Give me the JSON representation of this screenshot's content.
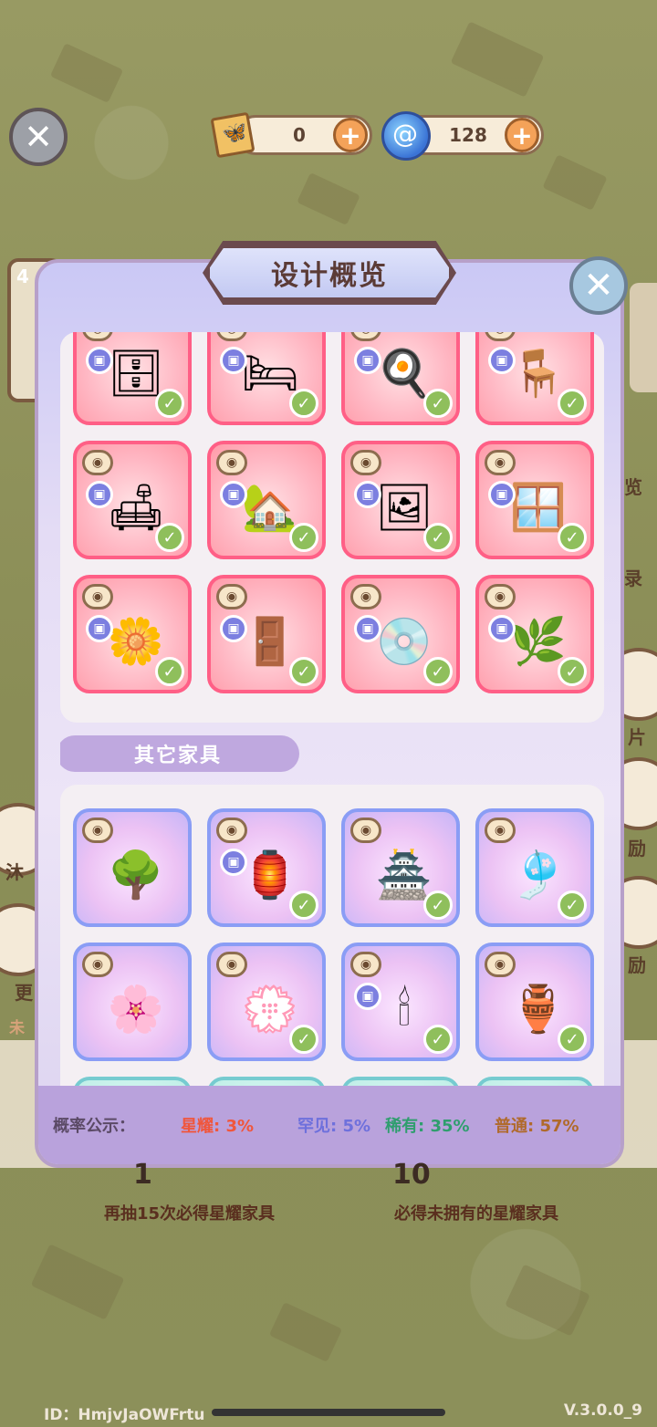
{
  "header": {
    "close_label": "✕",
    "currencies": [
      {
        "name": "butterfly-scroll",
        "value": "0",
        "plus": "+"
      },
      {
        "name": "blue-orb",
        "value": "128",
        "plus": "+"
      }
    ]
  },
  "dialog": {
    "title": "设计概览",
    "close_label": "✕",
    "sections": [
      {
        "items": [
          {
            "style": "pink",
            "name": "wooden-desk",
            "icon": "🗄",
            "badge": true,
            "check": true
          },
          {
            "style": "pink",
            "name": "flower-bed",
            "icon": "🛏",
            "badge": true,
            "check": true
          },
          {
            "style": "pink",
            "name": "kitchen-cabinet",
            "icon": "🍳",
            "badge": true,
            "check": true
          },
          {
            "style": "pink",
            "name": "office-chair",
            "icon": "🪑",
            "badge": true,
            "check": true
          },
          {
            "style": "pink",
            "name": "cream-sofa",
            "icon": "🛋",
            "badge": true,
            "check": true
          },
          {
            "style": "pink",
            "name": "flower-canopy-bed",
            "icon": "🏡",
            "badge": true,
            "check": true
          },
          {
            "style": "pink",
            "name": "easel",
            "icon": "🖼",
            "badge": true,
            "check": true
          },
          {
            "style": "pink",
            "name": "window-nook",
            "icon": "🪟",
            "badge": true,
            "check": true
          },
          {
            "style": "pink",
            "name": "flower-wall",
            "icon": "🌼",
            "badge": true,
            "check": true
          },
          {
            "style": "pink",
            "name": "wooden-door",
            "icon": "🚪",
            "badge": true,
            "check": true
          },
          {
            "style": "pink",
            "name": "record-shelf",
            "icon": "💿",
            "badge": true,
            "check": true
          },
          {
            "style": "pink",
            "name": "glass-counter",
            "icon": "🌿",
            "badge": true,
            "check": true
          }
        ]
      },
      {
        "label": "其它家具",
        "items": [
          {
            "style": "purple",
            "name": "tree",
            "icon": "🌳",
            "badge": false,
            "check": false
          },
          {
            "style": "purple",
            "name": "stone-lantern",
            "icon": "🏮",
            "badge": true,
            "check": true
          },
          {
            "style": "purple",
            "name": "lattice-screen",
            "icon": "🏯",
            "badge": false,
            "check": true
          },
          {
            "style": "purple",
            "name": "fan-lamp",
            "icon": "🎐",
            "badge": false,
            "check": true
          },
          {
            "style": "purple",
            "name": "blossom-rug",
            "icon": "🌸",
            "badge": false,
            "check": false
          },
          {
            "style": "purple",
            "name": "flower-mat",
            "icon": "💮",
            "badge": false,
            "check": true
          },
          {
            "style": "purple",
            "name": "candle",
            "icon": "🕯",
            "badge": true,
            "check": true
          },
          {
            "style": "purple",
            "name": "cherry-vase",
            "icon": "🏺",
            "badge": false,
            "check": true
          },
          {
            "style": "teal",
            "name": "teal-item-1",
            "icon": "",
            "badge": false,
            "check": false
          },
          {
            "style": "teal",
            "name": "teal-item-2",
            "icon": "",
            "badge": false,
            "check": false
          },
          {
            "style": "teal",
            "name": "teal-item-3",
            "icon": "",
            "badge": false,
            "check": false
          },
          {
            "style": "teal",
            "name": "teal-item-4",
            "icon": "",
            "badge": false,
            "check": false
          }
        ]
      }
    ],
    "probability": {
      "label": "概率公示：",
      "star": "星耀: 3%",
      "uncommon": "罕见: 5%",
      "rare": "稀有: 35%",
      "common": "普通: 57%"
    }
  },
  "bottom": {
    "left_num": "1",
    "right_num": "10",
    "left_text": "再抽15次必得星耀家具",
    "right_text": "必得未拥有的星耀家具",
    "id": "ID：HmjvJaOWFrtu",
    "version": "V.3.0.0_9"
  },
  "background_side_labels": {
    "left_1": "沐",
    "left_2": "更",
    "left_3": "未",
    "right_1": "览",
    "right_2": "录",
    "right_3": "片",
    "right_4": "励",
    "right_5": "励",
    "left_badge": "4"
  },
  "colors": {
    "star": "#f0563c",
    "uncommon": "#6e70dc",
    "rare": "#2f9e6e",
    "common": "#b06a2b",
    "pink_card_border": "#ff5f86",
    "purple_card_border": "#8a9df5"
  }
}
